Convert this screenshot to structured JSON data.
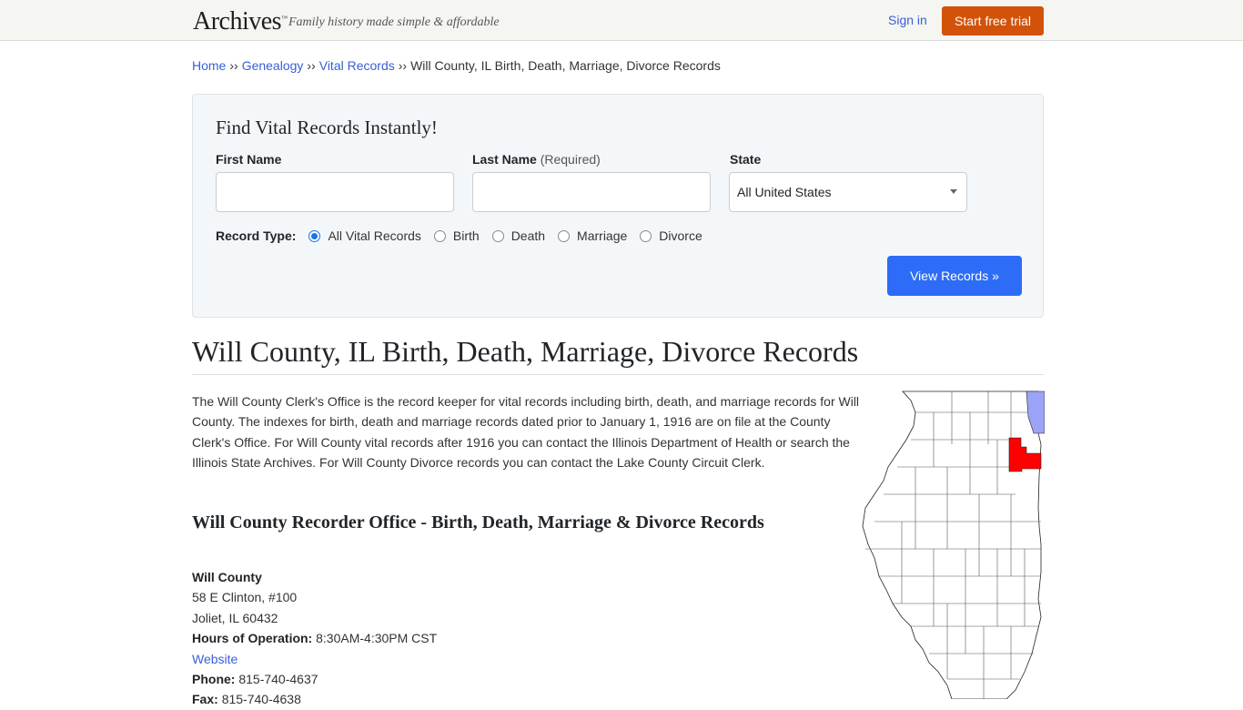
{
  "header": {
    "logo": "Archives",
    "logo_tm": "™",
    "tagline": "Family history made simple & affordable",
    "signin_label": "Sign in",
    "trial_label": "Start free trial",
    "trial_color": "#d2520a"
  },
  "breadcrumb": {
    "items": [
      "Home",
      "Genealogy",
      "Vital Records"
    ],
    "separator": "››",
    "current": "Will County, IL Birth, Death, Marriage, Divorce Records"
  },
  "search": {
    "title": "Find Vital Records Instantly!",
    "first_name_label": "First Name",
    "first_name_value": "",
    "last_name_label": "Last Name",
    "last_name_required": "(Required)",
    "last_name_value": "",
    "state_label": "State",
    "state_value": "All United States",
    "record_type_label": "Record Type:",
    "record_types": [
      {
        "label": "All Vital Records",
        "checked": true
      },
      {
        "label": "Birth",
        "checked": false
      },
      {
        "label": "Death",
        "checked": false
      },
      {
        "label": "Marriage",
        "checked": false
      },
      {
        "label": "Divorce",
        "checked": false
      }
    ],
    "submit_label": "View Records »",
    "submit_color": "#2d6cf6"
  },
  "main": {
    "title": "Will County, IL Birth, Death, Marriage, Divorce Records",
    "intro": "The Will County Clerk's Office is the record keeper for vital records including birth, death, and marriage records for Will County. The indexes for birth, death and marriage records dated prior to January 1, 1916 are on file at the County Clerk's Office. For Will County vital records after 1916 you can contact the Illinois Department of Health or search the Illinois State Archives. For Will County Divorce records you can contact the Lake County Circuit Clerk.",
    "subtitle": "Will County Recorder Office - Birth, Death, Marriage & Divorce Records",
    "office": {
      "name": "Will County",
      "address1": "58 E Clinton, #100",
      "address2": "Joliet, IL 60432",
      "hours_label": "Hours of Operation:",
      "hours": "8:30AM-4:30PM CST",
      "website_label": "Website",
      "phone_label": "Phone:",
      "phone": "815-740-4637",
      "fax_label": "Fax:",
      "fax": "815-740-4638"
    },
    "map": {
      "description": "Illinois county map with Will County highlighted",
      "highlight_color": "#ff0000",
      "lake_color": "#9aa3f5"
    }
  }
}
